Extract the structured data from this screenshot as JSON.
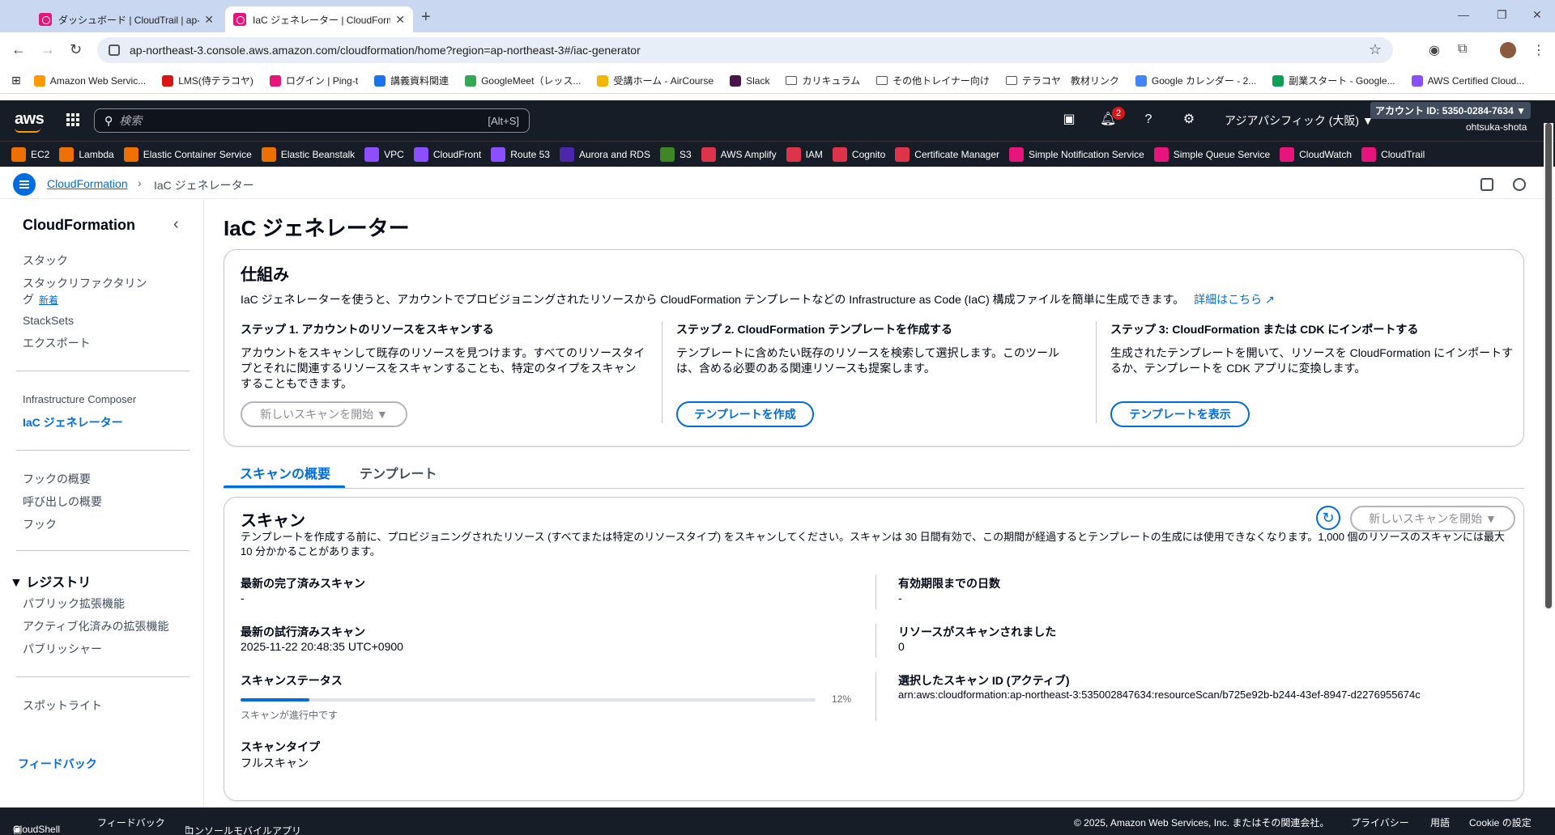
{
  "browser": {
    "tabs": [
      {
        "title": "ダッシュボード | CloudTrail | ap-nor"
      },
      {
        "title": "IaC ジェネレーター | CloudFormatio"
      }
    ],
    "url": "ap-northeast-3.console.aws.amazon.com/cloudformation/home?region=ap-northeast-3#/iac-generator",
    "bookmarks": [
      {
        "label": "Amazon Web Servic...",
        "color": "#ff9900"
      },
      {
        "label": "LMS(侍テラコヤ)",
        "color": "#d91515"
      },
      {
        "label": "ログイン | Ping-t",
        "color": "#e7157b"
      },
      {
        "label": "講義資料関連",
        "color": "#1a73e8"
      },
      {
        "label": "GoogleMeet（レッス...",
        "color": "#34a853"
      },
      {
        "label": "受講ホーム - AirCourse",
        "color": "#f4b400"
      },
      {
        "label": "Slack",
        "color": "#4a154b"
      },
      {
        "label": "カリキュラム",
        "folder": true
      },
      {
        "label": "その他トレイナー向け",
        "folder": true
      },
      {
        "label": "テラコヤ　教材リンク",
        "folder": true
      },
      {
        "label": "Google カレンダー - 2...",
        "color": "#4285f4"
      },
      {
        "label": "副業スタート - Google...",
        "color": "#0f9d58"
      },
      {
        "label": "AWS Certified Cloud...",
        "color": "#8c4fff"
      }
    ]
  },
  "aws_header": {
    "logo": "aws",
    "search_placeholder": "検索",
    "search_shortcut": "[Alt+S]",
    "notification_count": "2",
    "region": "アジアパシフィック (大阪) ▼",
    "account": "アカウント ID: 5350-0284-7634 ▼",
    "user": "ohtsuka-shota"
  },
  "services": [
    {
      "label": "EC2",
      "color": "#ed7100"
    },
    {
      "label": "Lambda",
      "color": "#ed7100"
    },
    {
      "label": "Elastic Container Service",
      "color": "#ed7100"
    },
    {
      "label": "Elastic Beanstalk",
      "color": "#ed7100"
    },
    {
      "label": "VPC",
      "color": "#8c4fff"
    },
    {
      "label": "CloudFront",
      "color": "#8c4fff"
    },
    {
      "label": "Route 53",
      "color": "#8c4fff"
    },
    {
      "label": "Aurora and RDS",
      "color": "#4d27aa"
    },
    {
      "label": "S3",
      "color": "#3f8624"
    },
    {
      "label": "AWS Amplify",
      "color": "#dd344c"
    },
    {
      "label": "IAM",
      "color": "#dd344c"
    },
    {
      "label": "Cognito",
      "color": "#dd344c"
    },
    {
      "label": "Certificate Manager",
      "color": "#dd344c"
    },
    {
      "label": "Simple Notification Service",
      "color": "#e7157b"
    },
    {
      "label": "Simple Queue Service",
      "color": "#e7157b"
    },
    {
      "label": "CloudWatch",
      "color": "#e7157b"
    },
    {
      "label": "CloudTrail",
      "color": "#e7157b"
    }
  ],
  "breadcrumb": {
    "parent": "CloudFormation",
    "current": "IaC ジェネレーター"
  },
  "sidebar": {
    "title": "CloudFormation",
    "items": [
      {
        "label": "スタック"
      },
      {
        "label": "スタックリファクタリン"
      },
      {
        "label": "グ"
      },
      {
        "label": "StackSets"
      },
      {
        "label": "エクスポート"
      },
      {
        "label": "Infrastructure Composer"
      },
      {
        "label": "IaC ジェネレーター"
      },
      {
        "label": "フックの概要"
      },
      {
        "label": "呼び出しの概要"
      },
      {
        "label": "フック"
      },
      {
        "label": "パブリック拡張機能"
      },
      {
        "label": "アクティブ化済みの拡張機能"
      },
      {
        "label": "パブリッシャー"
      },
      {
        "label": "スポットライト"
      }
    ],
    "new_badge": "新着",
    "registry_section": "レジストリ",
    "feedback": "フィードバック"
  },
  "main": {
    "title": "IaC ジェネレーター",
    "how_it_works": {
      "title": "仕組み",
      "description": "IaC ジェネレーターを使うと、アカウントでプロビジョニングされたリソースから CloudFormation テンプレートなどの Infrastructure as Code (IaC) 構成ファイルを簡単に生成できます。",
      "learn_more": "詳細はこちら",
      "steps": [
        {
          "title": "ステップ 1. アカウントのリソースをスキャンする",
          "body": "アカウントをスキャンして既存のリソースを見つけます。すべてのリソースタイプとそれに関連するリソースをスキャンすることも、特定のタイプをスキャンすることもできます。",
          "button": "新しいスキャンを開始 ▼"
        },
        {
          "title": "ステップ 2. CloudFormation テンプレートを作成する",
          "body": "テンプレートに含めたい既存のリソースを検索して選択します。このツールは、含める必要のある関連リソースも提案します。",
          "button": "テンプレートを作成"
        },
        {
          "title": "ステップ 3: CloudFormation または CDK にインポートする",
          "body": "生成されたテンプレートを開いて、リソースを CloudFormation にインポートするか、テンプレートを CDK アプリに変換します。",
          "button": "テンプレートを表示"
        }
      ]
    },
    "tabs": [
      {
        "label": "スキャンの概要"
      },
      {
        "label": "テンプレート"
      }
    ],
    "scan": {
      "title": "スキャン",
      "start_button": "新しいスキャンを開始 ▼",
      "description": "テンプレートを作成する前に、プロビジョニングされたリソース (すべてまたは特定のリソースタイプ) をスキャンしてください。スキャンは 30 日間有効で、この期間が経過するとテンプレートの生成には使用できなくなります。1,000 個のリソースのスキャンには最大 10 分かかることがあります。",
      "latest_completed_label": "最新の完了済みスキャン",
      "latest_completed_value": "-",
      "latest_attempted_label": "最新の試行済みスキャン",
      "latest_attempted_value": "2025-11-22 20:48:35 UTC+0900",
      "status_label": "スキャンステータス",
      "status_progress": 0.12,
      "status_percent": "12%",
      "status_note": "スキャンが進行中です",
      "type_label": "スキャンタイプ",
      "type_value": "フルスキャン",
      "days_label": "有効期限までの日数",
      "days_value": "-",
      "resources_label": "リソースがスキャンされました",
      "resources_value": "0",
      "scan_id_label": "選択したスキャン ID (アクティブ)",
      "scan_id_value": "arn:aws:cloudformation:ap-northeast-3:535002847634:resourceScan/b725e92b-b244-43ef-8947-d2276955674c"
    }
  },
  "footer": {
    "cloudshell": "CloudShell",
    "feedback": "フィードバック",
    "mobile": "コンソールモバイルアプリ",
    "copyright": "© 2025, Amazon Web Services, Inc. またはその関連会社。",
    "privacy": "プライバシー",
    "terms": "用語",
    "cookie": "Cookie の設定"
  }
}
